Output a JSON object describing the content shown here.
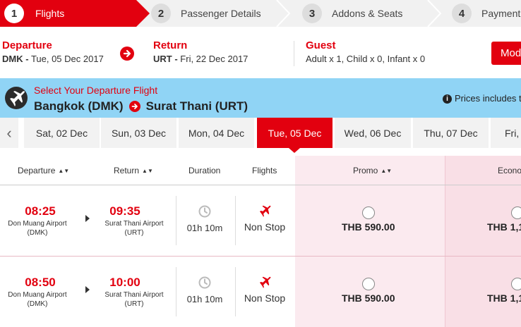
{
  "steps": [
    {
      "num": "1",
      "label": "Flights"
    },
    {
      "num": "2",
      "label": "Passenger Details"
    },
    {
      "num": "3",
      "label": "Addons & Seats"
    },
    {
      "num": "4",
      "label": "Payment"
    }
  ],
  "summary": {
    "departure": {
      "title": "Departure",
      "code": "DMK -",
      "date": "Tue, 05 Dec 2017"
    },
    "return": {
      "title": "Return",
      "code": "URT -",
      "date": "Fri, 22 Dec 2017"
    },
    "guest": {
      "title": "Guest",
      "detail": "Adult x 1, Child x 0, Infant x 0"
    },
    "modify_label": "Mod"
  },
  "banner": {
    "label": "Select Your Departure Flight",
    "origin": "Bangkok (DMK)",
    "destination": "Surat Thani (URT)",
    "prices_note": "Prices includes t"
  },
  "dates": [
    {
      "label": "Sat, 02 Dec",
      "active": false
    },
    {
      "label": "Sun, 03 Dec",
      "active": false
    },
    {
      "label": "Mon, 04 Dec",
      "active": false
    },
    {
      "label": "Tue, 05 Dec",
      "active": true
    },
    {
      "label": "Wed, 06 Dec",
      "active": false
    },
    {
      "label": "Thu, 07 Dec",
      "active": false
    },
    {
      "label": "Fri,",
      "active": false
    }
  ],
  "table": {
    "headers": {
      "departure": "Departure",
      "return": "Return",
      "duration": "Duration",
      "flights": "Flights",
      "promo": "Promo",
      "economy": "Econo"
    },
    "rows": [
      {
        "dep_time": "08:25",
        "dep_airport": "Don Muang Airport",
        "dep_code": "(DMK)",
        "arr_time": "09:35",
        "arr_airport": "Surat Thani Airport",
        "arr_code": "(URT)",
        "duration": "01h 10m",
        "stops": "Non Stop",
        "promo_price": "THB 590.00",
        "econ_price": "THB 1,1"
      },
      {
        "dep_time": "08:50",
        "dep_airport": "Don Muang Airport",
        "dep_code": "(DMK)",
        "arr_time": "10:00",
        "arr_airport": "Surat Thani Airport",
        "arr_code": "(URT)",
        "duration": "01h 10m",
        "stops": "Non Stop",
        "promo_price": "THB 590.00",
        "econ_price": "THB 1,1"
      }
    ]
  },
  "colors": {
    "brand_red": "#e2000f",
    "banner_blue": "#90d4f5",
    "promo_bg": "#fbeaef"
  },
  "icons": [
    "chevron-right-icon",
    "arrow-right-circle-icon",
    "plane-icon",
    "info-icon",
    "chevron-left-icon",
    "sort-icon",
    "clock-icon",
    "flight-icon"
  ]
}
